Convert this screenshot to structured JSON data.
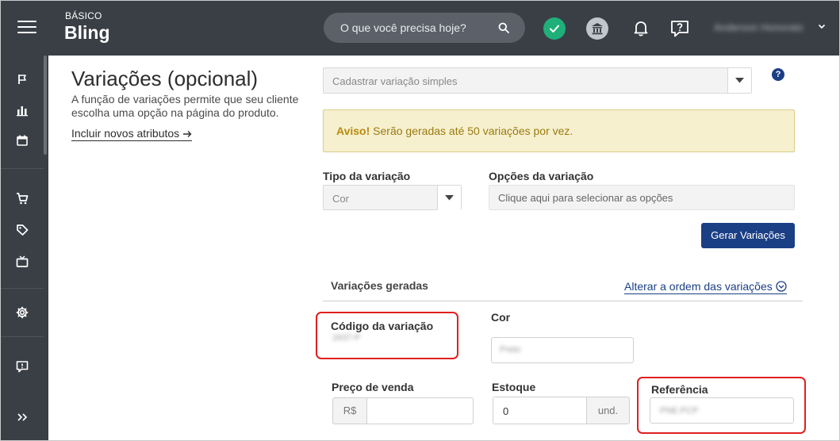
{
  "header": {
    "plan": "BÁSICO",
    "logo": "Bling",
    "search_placeholder": "O que você precisa hoje?",
    "user_name": "Anderson Honorato"
  },
  "left": {
    "title": "Variações (opcional)",
    "description": "A função de variações permite que seu cliente escolha uma opção na página do produto.",
    "include_link": "Incluir novos atributos"
  },
  "form": {
    "variation_select": "Cadastrar variação simples",
    "help": "?",
    "alert_strong": "Aviso!",
    "alert_text": "Serão geradas até 50 variações por vez.",
    "tipo_label": "Tipo da variação",
    "tipo_value": "Cor",
    "opcoes_label": "Opções da variação",
    "opcoes_placeholder": "Clique aqui para selecionar as opções",
    "generate_button": "Gerar Variações"
  },
  "generated": {
    "title": "Variações geradas",
    "order_link": "Alterar a ordem das variações",
    "codigo_label": "Código da variação",
    "codigo_value": "2637-P",
    "cor_label": "Cor",
    "cor_value": "Preto",
    "preco_label": "Preço de venda",
    "currency": "R$",
    "estoque_label": "Estoque",
    "estoque_value": "0",
    "unit": "und.",
    "referencia_label": "Referência",
    "referencia_value": "PNE.PCP"
  },
  "colors": {
    "topbar": "#3a3f46",
    "primary": "#1b3f85",
    "success": "#1fb07a",
    "highlight": "#e02020",
    "alert_bg": "#f6f0cf"
  },
  "icons": [
    "menu-icon",
    "search-icon",
    "check-icon",
    "bank-icon",
    "bell-icon",
    "help-chat-icon",
    "flag-icon",
    "bar-chart-icon",
    "calendar-icon",
    "cart-icon",
    "tag-icon",
    "tv-icon",
    "gear-icon",
    "feedback-icon",
    "expand-icon"
  ]
}
